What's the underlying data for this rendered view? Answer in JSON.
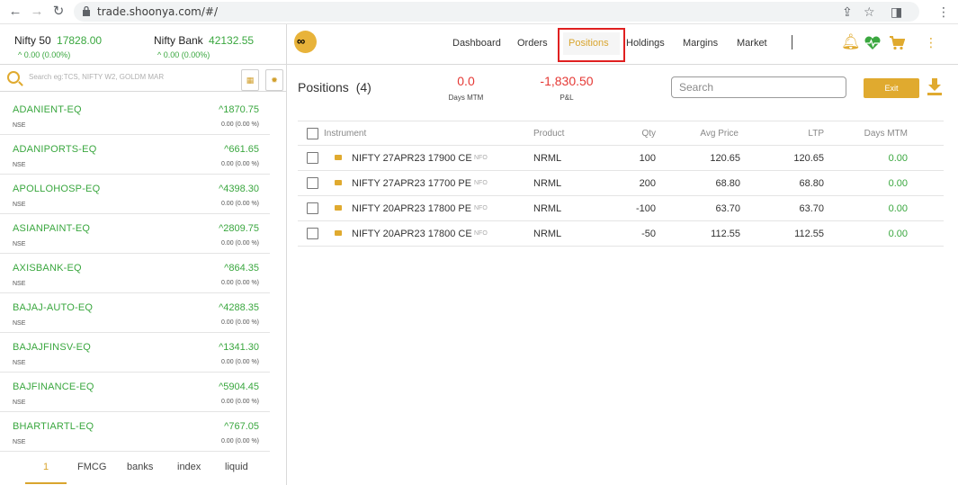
{
  "browser": {
    "url": "trade.shoonya.com/#/"
  },
  "header": {
    "indices": [
      {
        "name": "Nifty 50",
        "value": "17828.00",
        "change": "0.00 (0.00%)"
      },
      {
        "name": "Nifty Bank",
        "value": "42132.55",
        "change": "0.00 (0.00%)"
      }
    ],
    "menu": [
      "Dashboard",
      "Orders",
      "Positions",
      "Holdings",
      "Margins",
      "Market"
    ],
    "active_menu": "Positions"
  },
  "watchlist": {
    "search_placeholder": "Search eg:TCS, NIFTY W2, GOLDM MAR",
    "items": [
      {
        "symbol": "ADANIENT-EQ",
        "exchange": "NSE",
        "price": "1870.75",
        "change": "0.00 (0.00 %)"
      },
      {
        "symbol": "ADANIPORTS-EQ",
        "exchange": "NSE",
        "price": "661.65",
        "change": "0.00 (0.00 %)"
      },
      {
        "symbol": "APOLLOHOSP-EQ",
        "exchange": "NSE",
        "price": "4398.30",
        "change": "0.00 (0.00 %)"
      },
      {
        "symbol": "ASIANPAINT-EQ",
        "exchange": "NSE",
        "price": "2809.75",
        "change": "0.00 (0.00 %)"
      },
      {
        "symbol": "AXISBANK-EQ",
        "exchange": "NSE",
        "price": "864.35",
        "change": "0.00 (0.00 %)"
      },
      {
        "symbol": "BAJAJ-AUTO-EQ",
        "exchange": "NSE",
        "price": "4288.35",
        "change": "0.00 (0.00 %)"
      },
      {
        "symbol": "BAJAJFINSV-EQ",
        "exchange": "NSE",
        "price": "1341.30",
        "change": "0.00 (0.00 %)"
      },
      {
        "symbol": "BAJFINANCE-EQ",
        "exchange": "NSE",
        "price": "5904.45",
        "change": "0.00 (0.00 %)"
      },
      {
        "symbol": "BHARTIARTL-EQ",
        "exchange": "NSE",
        "price": "767.05",
        "change": "0.00 (0.00 %)"
      }
    ],
    "tabs": [
      "1",
      "FMCG",
      "banks",
      "index",
      "liquid"
    ]
  },
  "positions": {
    "title": "Positions",
    "count": "(4)",
    "days_mtm_value": "0.0",
    "days_mtm_label": "Days MTM",
    "pnl_value": "-1,830.50",
    "pnl_label": "P&L",
    "search_placeholder": "Search",
    "exit_label": "Exit",
    "columns": [
      "Instrument",
      "Product",
      "Qty",
      "Avg Price",
      "LTP",
      "Days MTM"
    ],
    "rows": [
      {
        "instrument": "NIFTY 27APR23 17900 CE",
        "exchange": "NFO",
        "product": "NRML",
        "qty": "100",
        "avg_price": "120.65",
        "ltp": "120.65",
        "days_mtm": "0.00"
      },
      {
        "instrument": "NIFTY 27APR23 17700 PE",
        "exchange": "NFO",
        "product": "NRML",
        "qty": "200",
        "avg_price": "68.80",
        "ltp": "68.80",
        "days_mtm": "0.00"
      },
      {
        "instrument": "NIFTY 20APR23 17800 PE",
        "exchange": "NFO",
        "product": "NRML",
        "qty": "-100",
        "avg_price": "63.70",
        "ltp": "63.70",
        "days_mtm": "0.00"
      },
      {
        "instrument": "NIFTY 20APR23 17800 CE",
        "exchange": "NFO",
        "product": "NRML",
        "qty": "-50",
        "avg_price": "112.55",
        "ltp": "112.55",
        "days_mtm": "0.00"
      }
    ]
  },
  "colors": {
    "accent": "#e0aa2f",
    "positive": "#3aa73f",
    "negative": "#e53935",
    "highlight_box": "#e02020"
  }
}
